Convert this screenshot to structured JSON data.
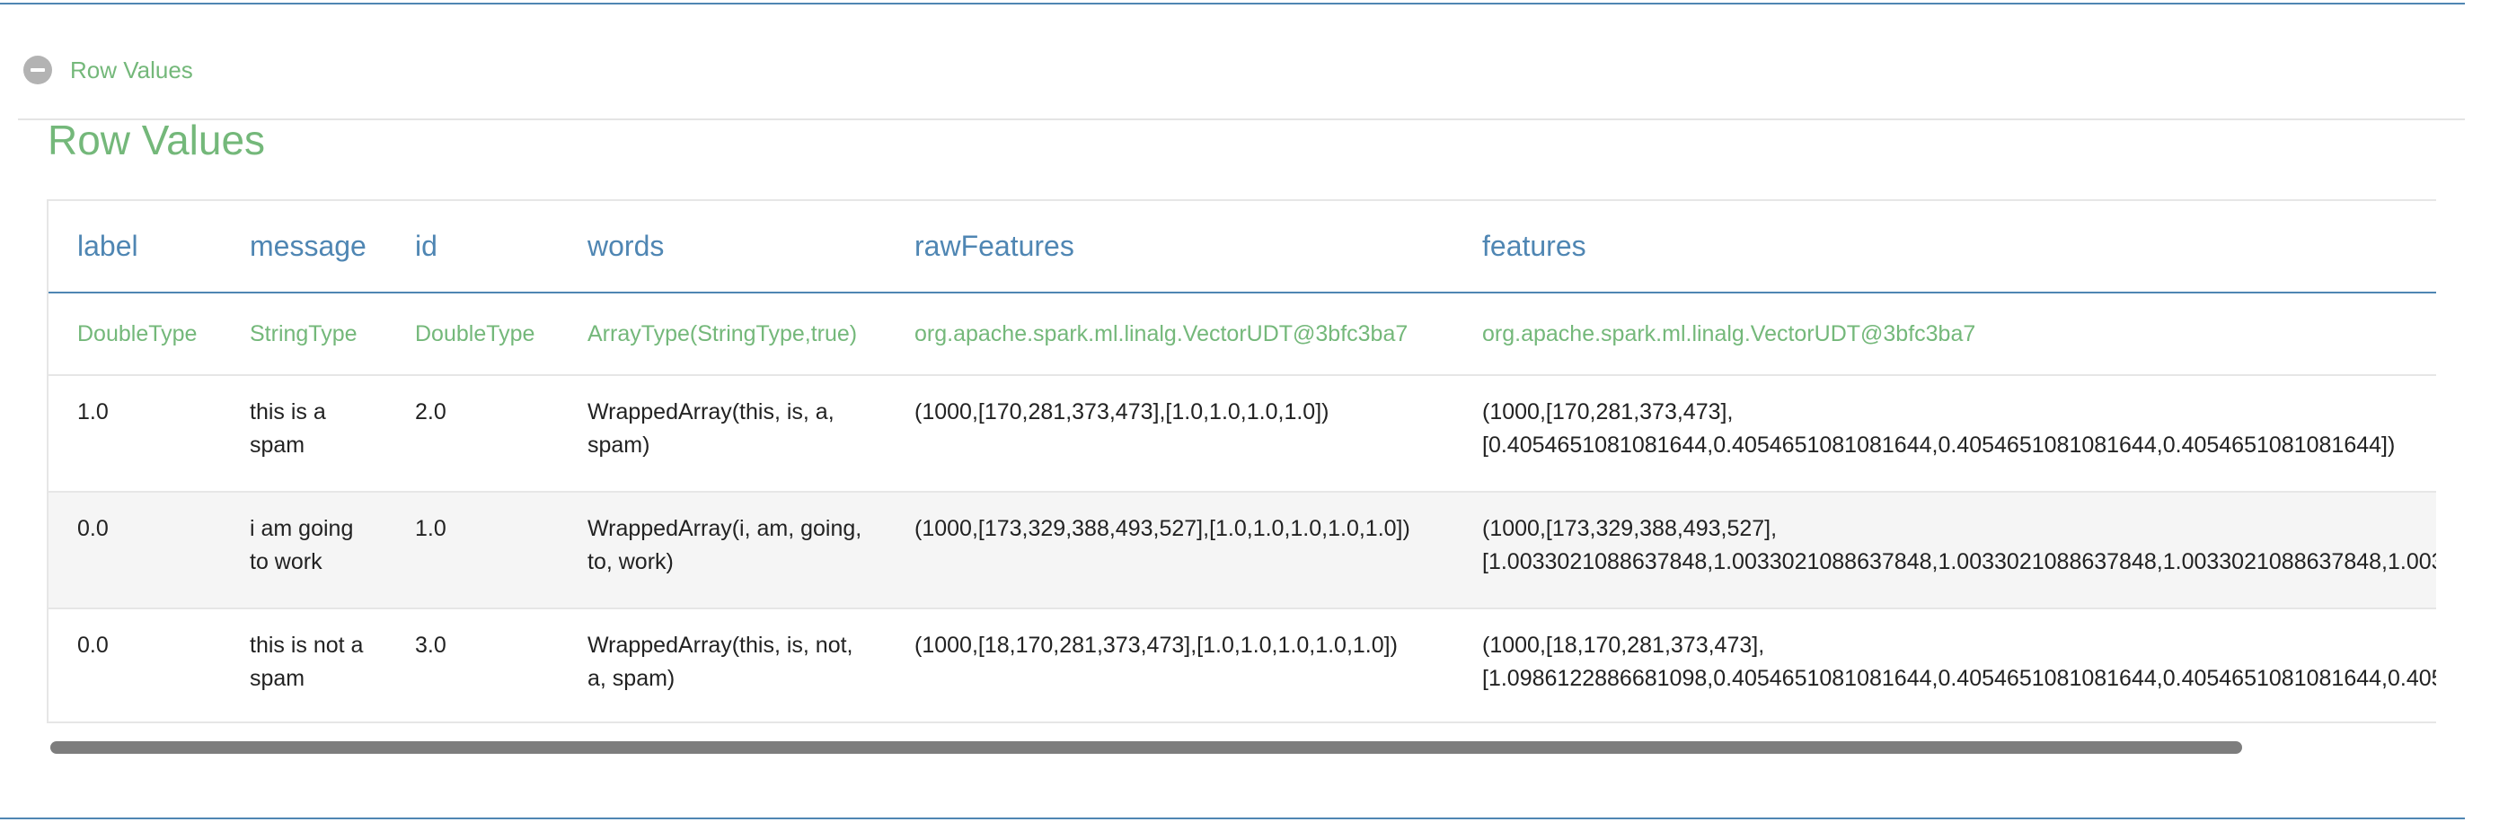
{
  "section": {
    "toggle_label": "Row Values",
    "title": "Row Values"
  },
  "table": {
    "columns": [
      "label",
      "message",
      "id",
      "words",
      "rawFeatures",
      "features"
    ],
    "types": [
      "DoubleType",
      "StringType",
      "DoubleType",
      "ArrayType(StringType,true)",
      "org.apache.spark.ml.linalg.VectorUDT@3bfc3ba7",
      "org.apache.spark.ml.linalg.VectorUDT@3bfc3ba7"
    ],
    "rows": [
      {
        "label": "1.0",
        "message": "this is a spam",
        "id": "2.0",
        "words": "WrappedArray(this, is, a, spam)",
        "rawFeatures": "(1000,[170,281,373,473],[1.0,1.0,1.0,1.0])",
        "features_line1": "(1000,[170,281,373,473],",
        "features_line2": "[0.4054651081081644,0.4054651081081644,0.4054651081081644,0.4054651081081644])"
      },
      {
        "label": "0.0",
        "message": "i am going to work",
        "id": "1.0",
        "words": "WrappedArray(i, am, going, to, work)",
        "rawFeatures": "(1000,[173,329,388,493,527],[1.0,1.0,1.0,1.0,1.0])",
        "features_line1": "(1000,[173,329,388,493,527],",
        "features_line2": "[1.0033021088637848,1.0033021088637848,1.0033021088637848,1.0033021088637848,1.003"
      },
      {
        "label": "0.0",
        "message": "this is not a spam",
        "id": "3.0",
        "words": "WrappedArray(this, is, not, a, spam)",
        "rawFeatures": "(1000,[18,170,281,373,473],[1.0,1.0,1.0,1.0,1.0])",
        "features_line1": "(1000,[18,170,281,373,473],",
        "features_line2": "[1.0986122886681098,0.4054651081081644,0.4054651081081644,0.4054651081081644,0.405"
      }
    ]
  },
  "icons": {
    "toggle": "minus-circle-icon"
  },
  "colors": {
    "accent_blue": "#4f86b3",
    "accent_green": "#74b87a",
    "scrollbar": "#7d7d7d"
  },
  "scroll": {
    "horizontal_visible_fraction": 0.92
  }
}
